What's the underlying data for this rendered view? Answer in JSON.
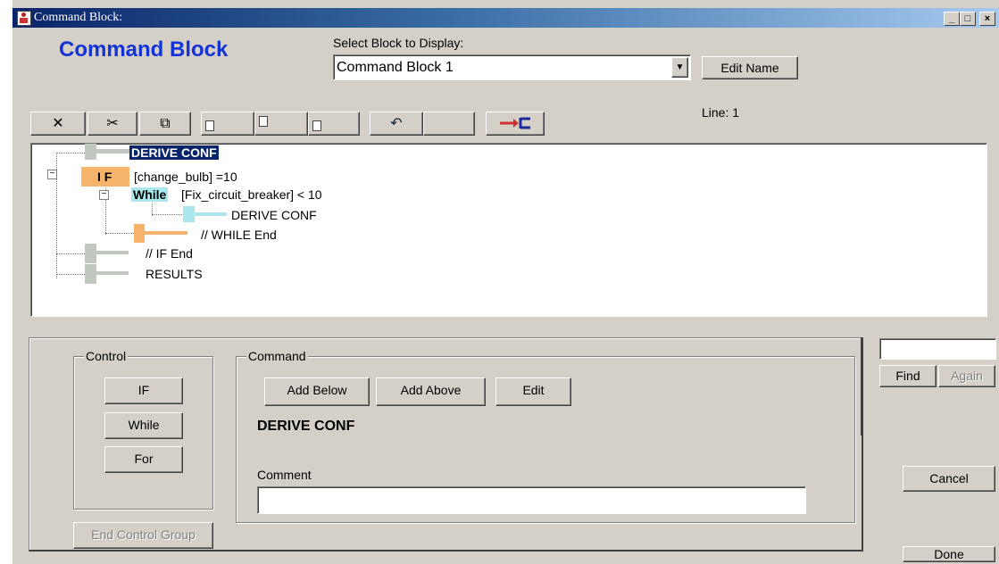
{
  "window": {
    "title": "Command Block:",
    "minimize": "_",
    "maximize": "□",
    "close": "×"
  },
  "header": {
    "title": "Command Block",
    "select_label": "Select Block to Display:",
    "selected_block": "Command Block 1",
    "edit_name": "Edit Name",
    "line_label": "Line: 1"
  },
  "toolbar": {
    "delete": "✕",
    "cut": "✂",
    "copy": "⧉",
    "undo": "↶"
  },
  "tree": {
    "items": [
      {
        "label": "DERIVE CONF"
      },
      {
        "keyword": "I F",
        "label": "[change_bulb] =10"
      },
      {
        "keyword": "While",
        "label": "[Fix_circuit_breaker] < 10"
      },
      {
        "label": "DERIVE CONF"
      },
      {
        "label": "// WHILE End"
      },
      {
        "label": "// IF End"
      },
      {
        "label": "RESULTS"
      }
    ]
  },
  "control": {
    "legend": "Control",
    "if": "IF",
    "while": "While",
    "for": "For",
    "end_group": "End Control Group"
  },
  "command": {
    "legend": "Command",
    "add_below": "Add Below",
    "add_above": "Add Above",
    "edit": "Edit",
    "current": "DERIVE CONF",
    "comment_label": "Comment",
    "comment_value": ""
  },
  "side": {
    "find_value": "",
    "find": "Find",
    "again": "Again",
    "cancel": "Cancel",
    "done": "Done"
  },
  "colors": {
    "gray_bar": "#c0c8c0",
    "if_orange": "#f5b46a",
    "while_cyan": "#a8e8ec",
    "selected": "#0a246a",
    "title_blue": "#1233d6"
  }
}
